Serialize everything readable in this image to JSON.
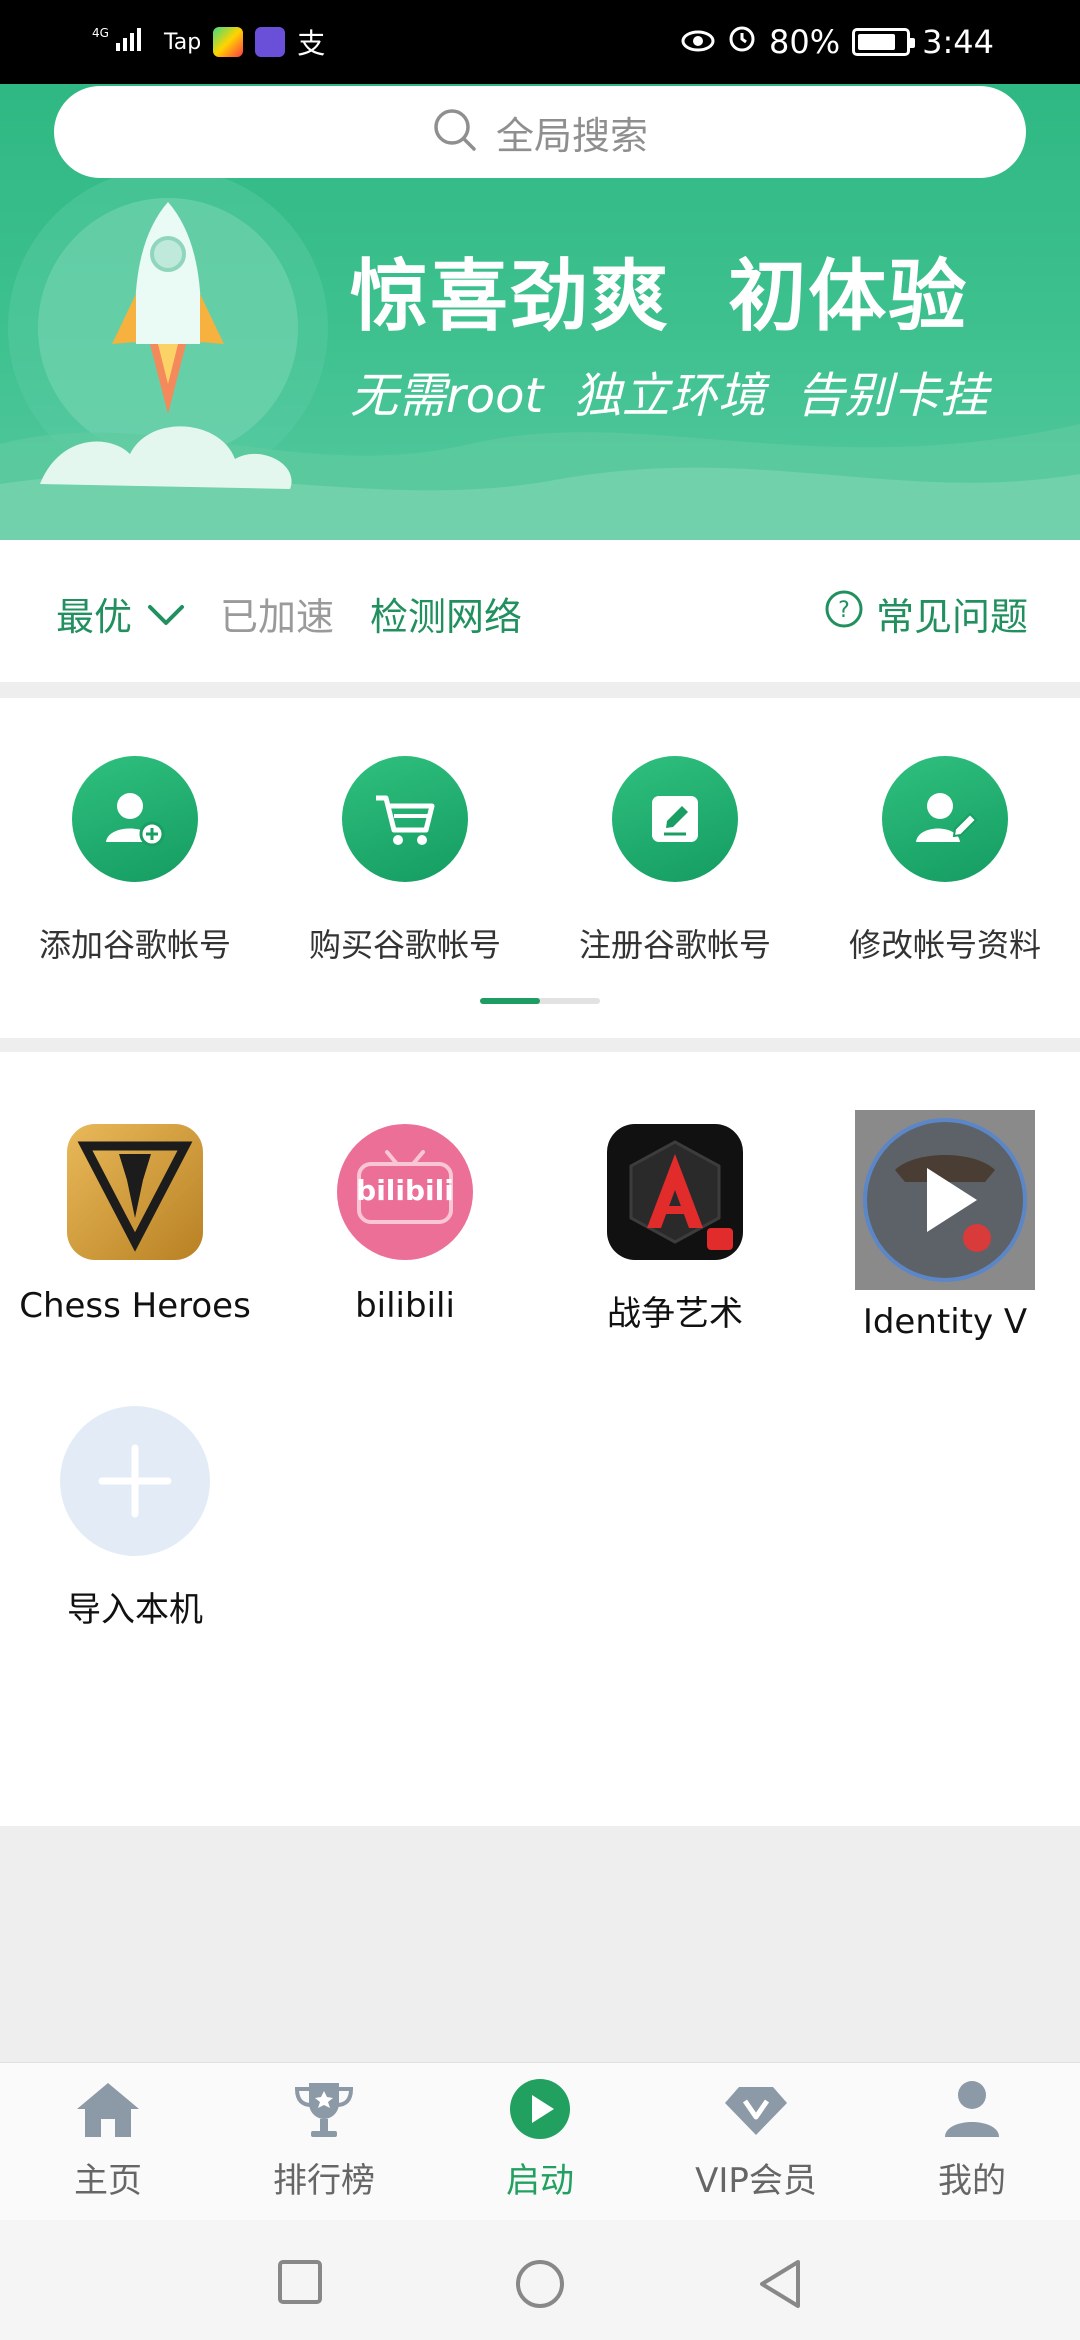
{
  "status_bar": {
    "network": "4G",
    "tap_label": "Tap",
    "battery_percent": "80%",
    "battery_level": 0.8,
    "time": "3:44"
  },
  "banner": {
    "search_placeholder": "全局搜索",
    "title": "惊喜劲爽  初体验",
    "subtitle": "无需root  独立环境  告别卡挂"
  },
  "network_row": {
    "mode": "最优",
    "status": "已加速",
    "check_label": "检测网络",
    "faq_label": "常见问题"
  },
  "actions": [
    {
      "label": "添加谷歌帐号",
      "icon": "add-user-icon"
    },
    {
      "label": "购买谷歌帐号",
      "icon": "cart-icon"
    },
    {
      "label": "注册谷歌帐号",
      "icon": "edit-icon"
    },
    {
      "label": "修改帐号资料",
      "icon": "user-edit-icon"
    }
  ],
  "pager": {
    "pages": 2,
    "active": 1
  },
  "apps": [
    {
      "label": "Chess Heroes",
      "icon": "chess-heroes-icon"
    },
    {
      "label": "bilibili",
      "icon": "bilibili-icon",
      "icon_text": "bilibili"
    },
    {
      "label": "战争艺术",
      "icon": "art-of-war-icon"
    },
    {
      "label": "Identity V",
      "icon": "identity-v-icon"
    },
    {
      "label": "导入本机",
      "icon": "plus-icon"
    }
  ],
  "bottom_nav": [
    {
      "label": "主页",
      "icon": "home-icon",
      "active": false
    },
    {
      "label": "排行榜",
      "icon": "trophy-icon",
      "active": false
    },
    {
      "label": "启动",
      "icon": "play-icon",
      "active": true
    },
    {
      "label": "VIP会员",
      "icon": "vip-icon",
      "active": false
    },
    {
      "label": "我的",
      "icon": "profile-icon",
      "active": false
    }
  ],
  "colors": {
    "brand_green": "#21905e",
    "banner_green": "#3ec18f",
    "active_nav": "#21a060"
  }
}
